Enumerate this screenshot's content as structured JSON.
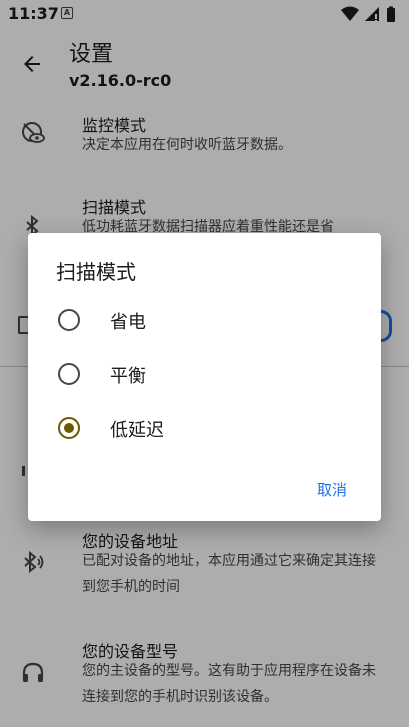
{
  "status": {
    "time": "11:37",
    "notif_letter": "A"
  },
  "appbar": {
    "title": "设置",
    "version": "v2.16.0-rc0"
  },
  "settings": [
    {
      "title": "监控模式",
      "summary": "决定本应用在何时收听蓝牙数据。"
    },
    {
      "title": "扫描模式",
      "summary": "低功耗蓝牙数据扫描器应着重性能还是省"
    },
    {
      "title": "您的设备地址",
      "summary": "已配对设备的地址，本应用通过它来确定其连接到您手机的时间"
    },
    {
      "title": "您的设备型号",
      "summary": "您的主设备的型号。这有助于应用程序在设备未连接到您的手机时识别该设备。"
    }
  ],
  "dialog": {
    "title": "扫描模式",
    "options": [
      {
        "label": "省电",
        "checked": false
      },
      {
        "label": "平衡",
        "checked": false
      },
      {
        "label": "低延迟",
        "checked": true
      }
    ],
    "cancel_label": "取消"
  },
  "colors": {
    "accent": "#1a73e8",
    "radio_checked": "#6b5900",
    "scrim": "rgba(0,0,0,0.32)"
  }
}
